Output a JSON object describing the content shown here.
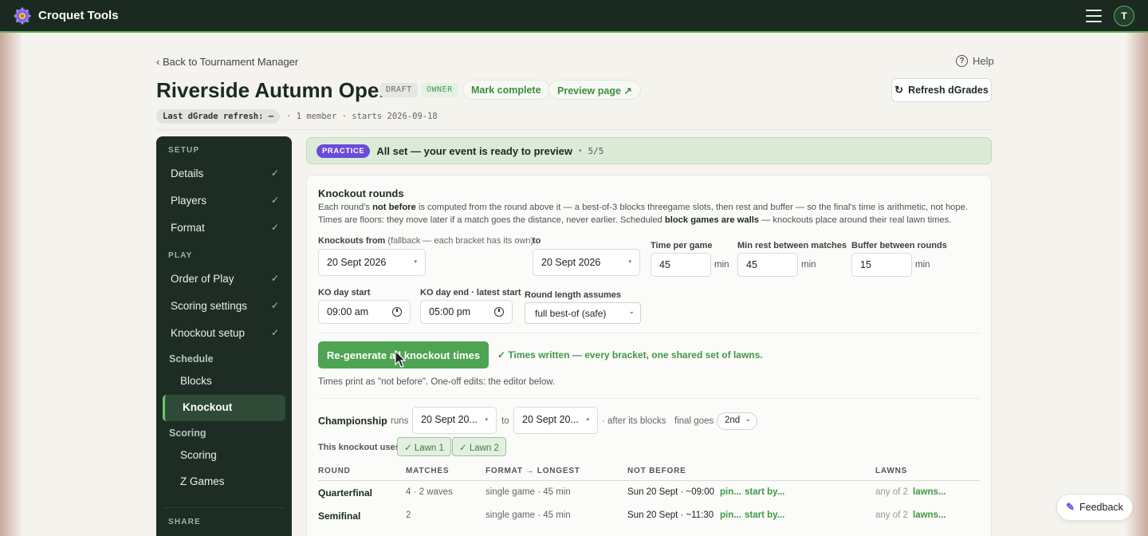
{
  "app": {
    "brand": "Croquet Tools",
    "avatar_initial": "T"
  },
  "nav": {
    "back": "‹ Back to Tournament Manager",
    "help": "Help"
  },
  "header": {
    "title": "Riverside Autumn Open",
    "draft_badge": "DRAFT",
    "owner_badge": "OWNER",
    "mark_complete": "Mark complete",
    "preview_page": "Preview page ↗",
    "refresh": "Refresh dGrades",
    "meta_tag": "Last dGrade refresh: —",
    "meta_text": "· 1 member · starts 2026-09-18"
  },
  "sidebar": {
    "setup_label": "SETUP",
    "play_label": "PLAY",
    "share_label": "SHARE",
    "items": [
      {
        "label": "Details",
        "check": "✓"
      },
      {
        "label": "Players",
        "check": "✓"
      },
      {
        "label": "Format",
        "check": "✓"
      },
      {
        "label": "Order of Play",
        "check": "✓"
      },
      {
        "label": "Scoring settings",
        "check": "✓"
      },
      {
        "label": "Knockout setup",
        "check": "✓"
      }
    ],
    "schedule_label": "Schedule",
    "schedule_items": [
      "Blocks",
      "Knockout"
    ],
    "scoring_label": "Scoring",
    "scoring_items": [
      "Scoring",
      "Z Games"
    ]
  },
  "banner": {
    "tag": "PRACTICE",
    "message": "All set — your event is ready to preview",
    "dot": "•",
    "count": "5/5"
  },
  "knockout": {
    "title": "Knockout rounds",
    "desc_1a": "Each round's ",
    "desc_1b": "not before",
    "desc_1c": " is computed from the round above it — a best-of-3 blocks threegame slots, then rest and buffer — so the final's time is arithmetic, not hope.",
    "desc_2a": "Times are floors: they move later if a match goes the distance, never earlier. Scheduled ",
    "desc_2b": "block games are walls",
    "desc_2c": " — knockouts place around their real lawn times.",
    "from_label": "Knockouts from",
    "from_hint": " (fallback — each bracket has its own)",
    "from_value": "20 Sept 2026",
    "to_label": "to",
    "to_value": "20 Sept 2026",
    "time_per_game_label": "Time per game",
    "time_per_game": "45",
    "min_rest_label": "Min rest between matches",
    "min_rest": "45",
    "buffer_label": "Buffer between rounds",
    "buffer": "15",
    "unit": "min",
    "ko_start_label": "KO day start",
    "ko_start": "09:00 am",
    "ko_end_label": "KO day end · latest start",
    "ko_end": "05:00 pm",
    "round_len_label": "Round length assumes",
    "round_len": "full best-of (safe)",
    "regen": "Re-generate all knockout times",
    "written": "✓ Times written — every bracket, one shared set of lawns.",
    "note": "Times print as \"not before\". One-off edits: the editor below."
  },
  "championship": {
    "name": "Championship",
    "runs": "runs",
    "from": "20 Sept 20...",
    "to_word": "to",
    "to": "20 Sept 20...",
    "after": "· after its blocks",
    "final_goes": "final goes",
    "final_value": "2nd",
    "uses": "This knockout uses",
    "lawns": [
      "✓ Lawn 1",
      "✓ Lawn 2"
    ]
  },
  "table": {
    "headers": [
      "ROUND",
      "MATCHES",
      "FORMAT → LONGEST",
      "NOT BEFORE",
      "LAWNS"
    ],
    "rows": [
      {
        "round": "Quarterfinal",
        "matches": "4 · 2 waves",
        "format": "single game · 45 min",
        "not_before": "Sun 20 Sept · ~09:00",
        "pin": "pin...",
        "start": "start by...",
        "lawns_any": "any of 2",
        "lawns_link": "lawns..."
      },
      {
        "round": "Semifinal",
        "matches": "2",
        "format": "single game · 45 min",
        "not_before": "Sun 20 Sept · ~11:30",
        "pin": "pin...",
        "start": "start by...",
        "lawns_any": "any of 2",
        "lawns_link": "lawns..."
      }
    ]
  },
  "feedback": "Feedback"
}
